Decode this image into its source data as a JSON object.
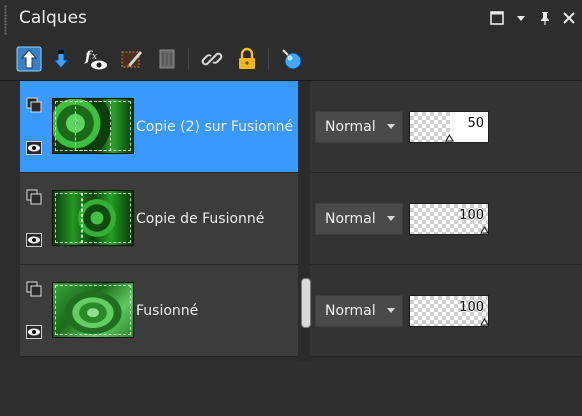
{
  "panel": {
    "title": "Calques"
  },
  "toolbar": {
    "tools": [
      {
        "icon": "move-layer-up-icon",
        "active": true
      },
      {
        "icon": "move-layer-down-icon",
        "active": false
      },
      {
        "icon": "layer-effects-fx-eye-icon",
        "active": false
      },
      {
        "icon": "edit-layer-brush-icon",
        "active": false
      },
      {
        "icon": "delete-layer-icon",
        "active": false
      },
      {
        "icon": "link-icon",
        "active": false
      },
      {
        "icon": "lock-icon",
        "active": false
      },
      {
        "icon": "highlight-layer-icon",
        "active": false
      }
    ]
  },
  "layers": [
    {
      "name": "Copie (2) sur Fusionné",
      "blend": "Normal",
      "opacity": "50",
      "opacity_fraction": 0.5,
      "selected": true
    },
    {
      "name": "Copie de Fusionné",
      "blend": "Normal",
      "opacity": "100",
      "opacity_fraction": 1.0,
      "selected": false
    },
    {
      "name": "Fusionné",
      "blend": "Normal",
      "opacity": "100",
      "opacity_fraction": 1.0,
      "selected": false
    }
  ],
  "colors": {
    "selection": "#3999ff",
    "background": "#2d2d2d",
    "row": "#3c3c3c"
  }
}
